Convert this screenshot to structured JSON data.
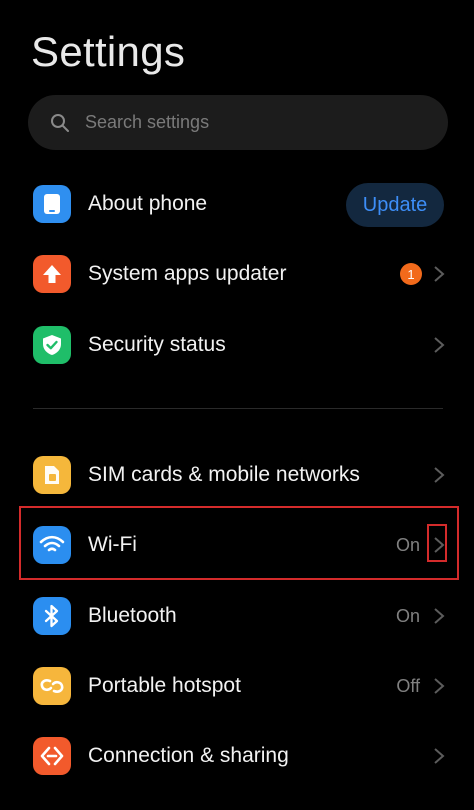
{
  "header": {
    "title": "Settings"
  },
  "search": {
    "placeholder": "Search settings"
  },
  "items": [
    {
      "label": "About phone",
      "action": "Update",
      "icon": "phone-icon",
      "color": "#2f8ff0"
    },
    {
      "label": "System apps updater",
      "badge": "1",
      "icon": "arrow-up-icon",
      "color": "#f25a2c"
    },
    {
      "label": "Security status",
      "icon": "shield-check-icon",
      "color": "#1fbe69"
    },
    {
      "label": "SIM cards & mobile networks",
      "icon": "sim-card-icon",
      "color": "#f5b73b"
    },
    {
      "label": "Wi-Fi",
      "value": "On",
      "icon": "wifi-icon",
      "color": "#2b8ef0"
    },
    {
      "label": "Bluetooth",
      "value": "On",
      "icon": "bluetooth-icon",
      "color": "#2b8ef0"
    },
    {
      "label": "Portable hotspot",
      "value": "Off",
      "icon": "hotspot-link-icon",
      "color": "#f6b63c"
    },
    {
      "label": "Connection & sharing",
      "icon": "connection-sharing-icon",
      "color": "#f25a2c"
    }
  ],
  "colors": {
    "background": "#000000",
    "accent": "#3d8ef7",
    "highlight": "#d42b2b"
  }
}
